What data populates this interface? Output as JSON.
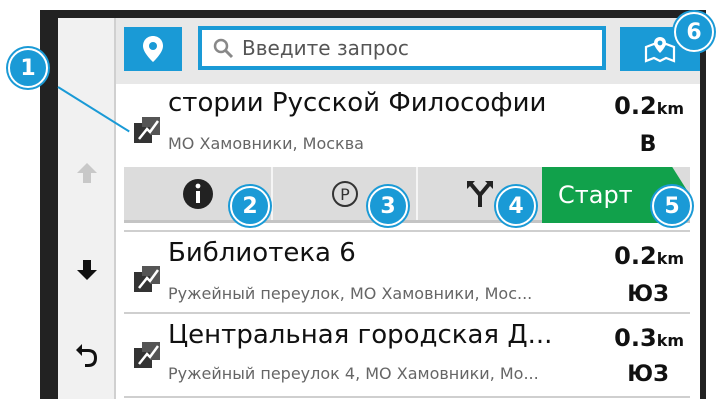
{
  "search": {
    "placeholder": "Введите запрос"
  },
  "selected": {
    "title": "стории Русской Философии",
    "subtitle": "МО Хамовники, Москва",
    "distance": "0.2",
    "unit": "km",
    "direction": "В"
  },
  "actions": {
    "start_label": "Старт"
  },
  "results": [
    {
      "title": "Библиотека 6",
      "subtitle": "Ружейный переулок, МО Хамовники, Мос...",
      "distance": "0.2",
      "unit": "km",
      "direction": "ЮЗ"
    },
    {
      "title": "Центральная городская Д...",
      "subtitle": "Ружейный переулок 4, МО Хамовники, Мо...",
      "distance": "0.3",
      "unit": "km",
      "direction": "ЮЗ"
    }
  ],
  "callouts": [
    "1",
    "2",
    "3",
    "4",
    "5",
    "6"
  ],
  "colors": {
    "accent": "#1a9ad6",
    "start": "#11a14b",
    "device": "#222222"
  },
  "icons": [
    "pin-icon",
    "search-icon",
    "map-icon",
    "up-arrow-icon",
    "down-arrow-icon",
    "back-icon",
    "info-icon",
    "parking-icon",
    "fork-icon",
    "poi-icon"
  ]
}
